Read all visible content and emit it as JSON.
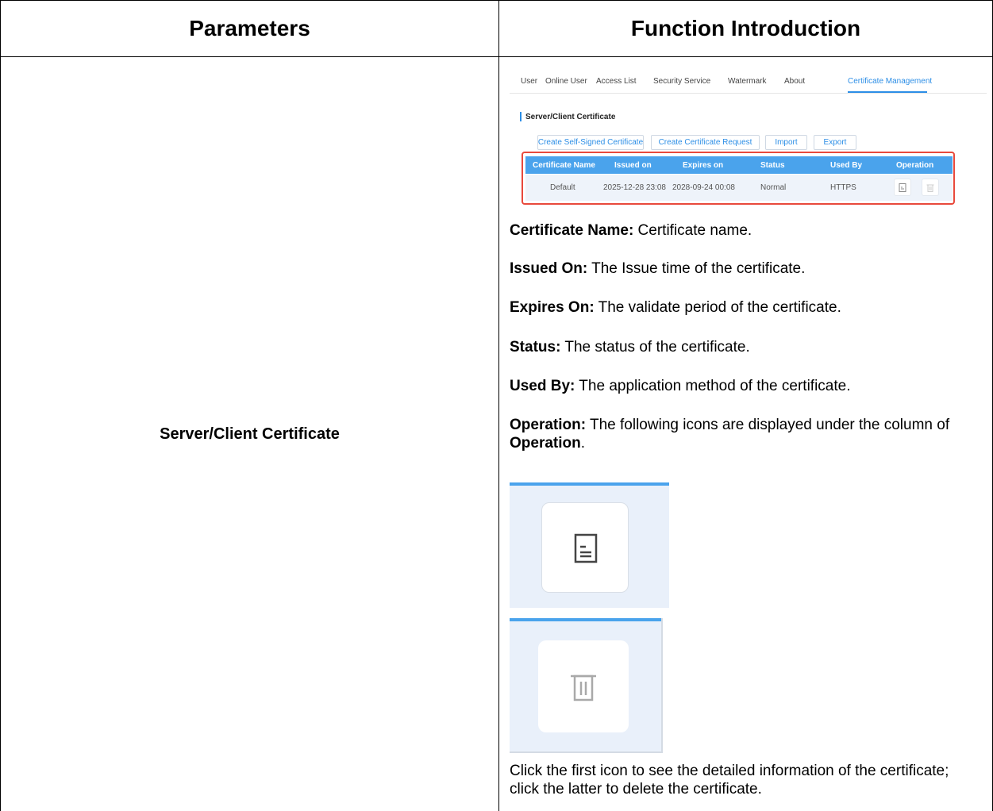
{
  "table": {
    "header_parameters": "Parameters",
    "header_function": "Function Introduction",
    "param_name": "Server/Client Certificate"
  },
  "screenshot": {
    "tabs": [
      "User",
      "Online User",
      "Access List",
      "Security Service",
      "Watermark",
      "About",
      "Certificate Management"
    ],
    "active_tab": "Certificate Management",
    "section_title": "Server/Client Certificate",
    "buttons": [
      "Create Self-Signed Certificate",
      "Create Certificate Request",
      "Import",
      "Export"
    ],
    "columns": [
      "Certificate Name",
      "Issued on",
      "Expires on",
      "Status",
      "Used By",
      "Operation"
    ],
    "row": {
      "name": "Default",
      "issued": "2025-12-28 23:08",
      "expires": "2028-09-24 00:08",
      "status": "Normal",
      "used_by": "HTTPS"
    },
    "accent_color": "#2c8ee6",
    "highlight_color": "#e8493c"
  },
  "descriptions": [
    {
      "term": "Certificate Name:",
      "text": " Certificate name."
    },
    {
      "term": "Issued On:",
      "text": " The Issue time of the certificate."
    },
    {
      "term": "Expires On:",
      "text": " The validate period of the certificate."
    },
    {
      "term": "Status:",
      "text": " The status of the certificate."
    },
    {
      "term": "Used By:",
      "text": " The application method of the certificate."
    }
  ],
  "operation": {
    "term": "Operation:",
    "text_before": " The following icons are displayed under the column of ",
    "term2": "Operation",
    "text_after": "."
  },
  "icons": [
    "detail-icon",
    "delete-icon"
  ],
  "footer_text": "Click the first icon to see the detailed information of the certificate; click the latter to delete the certificate."
}
